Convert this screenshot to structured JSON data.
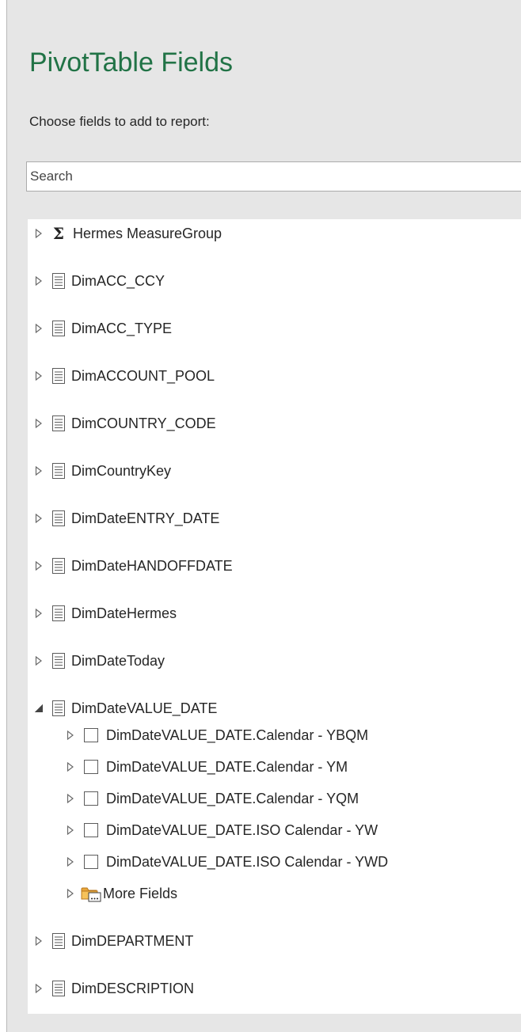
{
  "panel": {
    "title": "PivotTable Fields",
    "subtitle": "Choose fields to add to report:",
    "search_placeholder": "Search",
    "accent_color": "#217346"
  },
  "fields": [
    {
      "label": "Hermes MeasureGroup",
      "icon": "sigma-icon",
      "expanded": false
    },
    {
      "label": "DimACC_CCY",
      "icon": "table-icon",
      "expanded": false
    },
    {
      "label": "DimACC_TYPE",
      "icon": "table-icon",
      "expanded": false
    },
    {
      "label": "DimACCOUNT_POOL",
      "icon": "table-icon",
      "expanded": false
    },
    {
      "label": "DimCOUNTRY_CODE",
      "icon": "table-icon",
      "expanded": false
    },
    {
      "label": "DimCountryKey",
      "icon": "table-icon",
      "expanded": false
    },
    {
      "label": "DimDateENTRY_DATE",
      "icon": "table-icon",
      "expanded": false
    },
    {
      "label": "DimDateHANDOFFDATE",
      "icon": "table-icon",
      "expanded": false
    },
    {
      "label": "DimDateHermes",
      "icon": "table-icon",
      "expanded": false
    },
    {
      "label": "DimDateToday",
      "icon": "table-icon",
      "expanded": false
    },
    {
      "label": "DimDateVALUE_DATE",
      "icon": "table-icon",
      "expanded": true,
      "children": [
        {
          "label": "DimDateVALUE_DATE.Calendar - YBQM",
          "kind": "checkbox",
          "checked": false
        },
        {
          "label": "DimDateVALUE_DATE.Calendar - YM",
          "kind": "checkbox",
          "checked": false
        },
        {
          "label": "DimDateVALUE_DATE.Calendar - YQM",
          "kind": "checkbox",
          "checked": false
        },
        {
          "label": "DimDateVALUE_DATE.ISO Calendar - YW",
          "kind": "checkbox",
          "checked": false
        },
        {
          "label": "DimDateVALUE_DATE.ISO Calendar - YWD",
          "kind": "checkbox",
          "checked": false
        },
        {
          "label": "More Fields",
          "kind": "folder",
          "icon": "folder-more-icon"
        }
      ]
    },
    {
      "label": "DimDEPARTMENT",
      "icon": "table-icon",
      "expanded": false
    },
    {
      "label": "DimDESCRIPTION",
      "icon": "table-icon",
      "expanded": false
    }
  ]
}
